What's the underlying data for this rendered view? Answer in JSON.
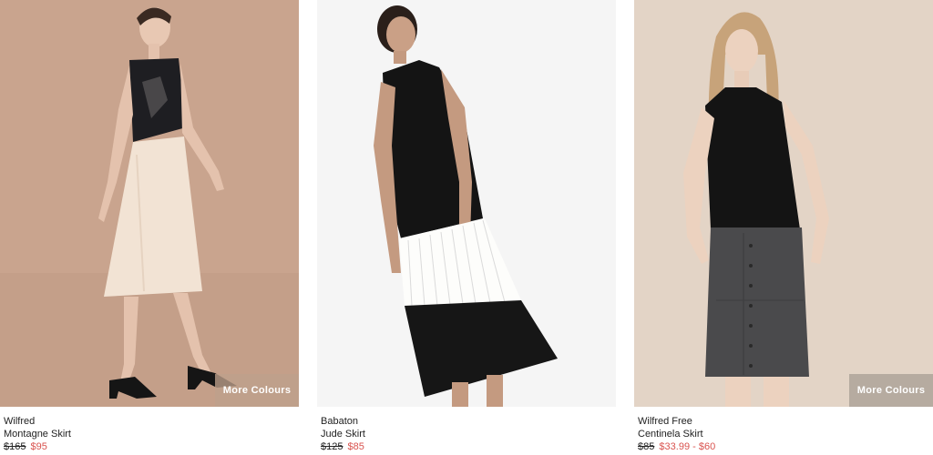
{
  "products": [
    {
      "brand": "Wilfred",
      "name": "Montagne Skirt",
      "price_original": "$165",
      "price_sale": "$95",
      "more_colours_label": "More Colours"
    },
    {
      "brand": "Babaton",
      "name": "Jude Skirt",
      "price_original": "$125",
      "price_sale": "$85"
    },
    {
      "brand": "Wilfred Free",
      "name": "Centinela Skirt",
      "price_original": "$85",
      "price_sale_low": "$33.99",
      "price_separator": " - ",
      "price_sale_high": "$60",
      "more_colours_label": "More Colours"
    }
  ],
  "colors": {
    "sale_price": "#d9534f",
    "more_colours_overlay": "#bea08c"
  }
}
